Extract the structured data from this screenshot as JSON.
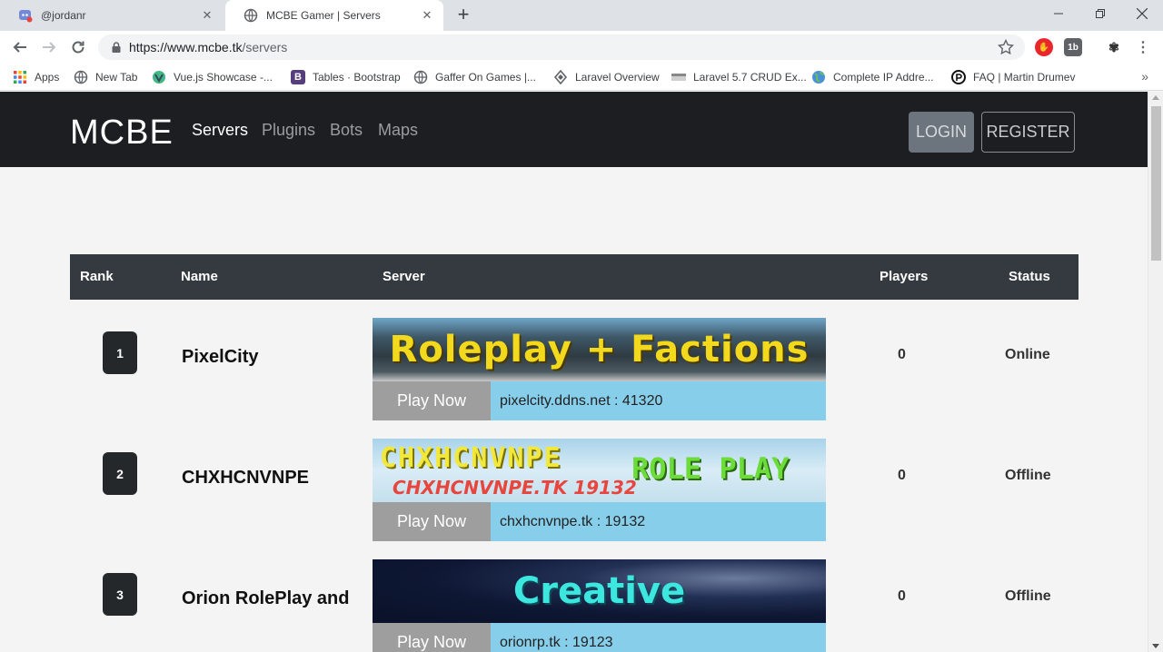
{
  "browser": {
    "tabs": [
      {
        "title": "@jordanr",
        "active": false
      },
      {
        "title": "MCBE Gamer | Servers",
        "active": true
      }
    ],
    "url_host": "https://www.mcbe.tk",
    "url_path": "/servers",
    "bookmarks": [
      {
        "label": "Apps",
        "icon": "apps-grid-icon"
      },
      {
        "label": "New Tab",
        "icon": "globe-icon"
      },
      {
        "label": "Vue.js Showcase -...",
        "icon": "vue-icon"
      },
      {
        "label": "Tables · Bootstrap",
        "icon": "bootstrap-icon"
      },
      {
        "label": "Gaffer On Games |...",
        "icon": "globe-icon"
      },
      {
        "label": "Laravel Overview",
        "icon": "laravel-icon"
      },
      {
        "label": "Laravel 5.7 CRUD Ex...",
        "icon": "site-icon"
      },
      {
        "label": "Complete IP Addre...",
        "icon": "earth-icon"
      },
      {
        "label": "FAQ | Martin Drumev",
        "icon": "site-icon"
      }
    ],
    "more_bookmarks": "»"
  },
  "site": {
    "brand": "MCBE",
    "nav": [
      "Servers",
      "Plugins",
      "Bots",
      "Maps"
    ],
    "active_nav": "Servers",
    "login": "LOGIN",
    "register": "REGISTER"
  },
  "table": {
    "headers": {
      "rank": "Rank",
      "name": "Name",
      "server": "Server",
      "players": "Players",
      "status": "Status"
    },
    "play_label": "Play Now",
    "rows": [
      {
        "rank": "1",
        "name": "PixelCity",
        "banner": [
          "Roleplay + Factions"
        ],
        "address": "pixelcity.ddns.net : 41320",
        "players": "0",
        "status": "Online"
      },
      {
        "rank": "2",
        "name": "CHXHCNVNPE",
        "banner": [
          "CHXHCNVNPE",
          "ROLE PLAY",
          "CHXHCNVNPE.TK 19132"
        ],
        "address": "chxhcnvnpe.tk : 19132",
        "players": "0",
        "status": "Offline"
      },
      {
        "rank": "3",
        "name": "Orion RolePlay and",
        "banner": [
          "Creative"
        ],
        "address": "orionrp.tk : 19123",
        "players": "0",
        "status": "Offline"
      }
    ]
  },
  "colors": {
    "nav_bg": "#1c1e21",
    "table_header_bg": "#343a40",
    "play_button": "#9e9e9e",
    "address_bg": "#87ceeb"
  }
}
